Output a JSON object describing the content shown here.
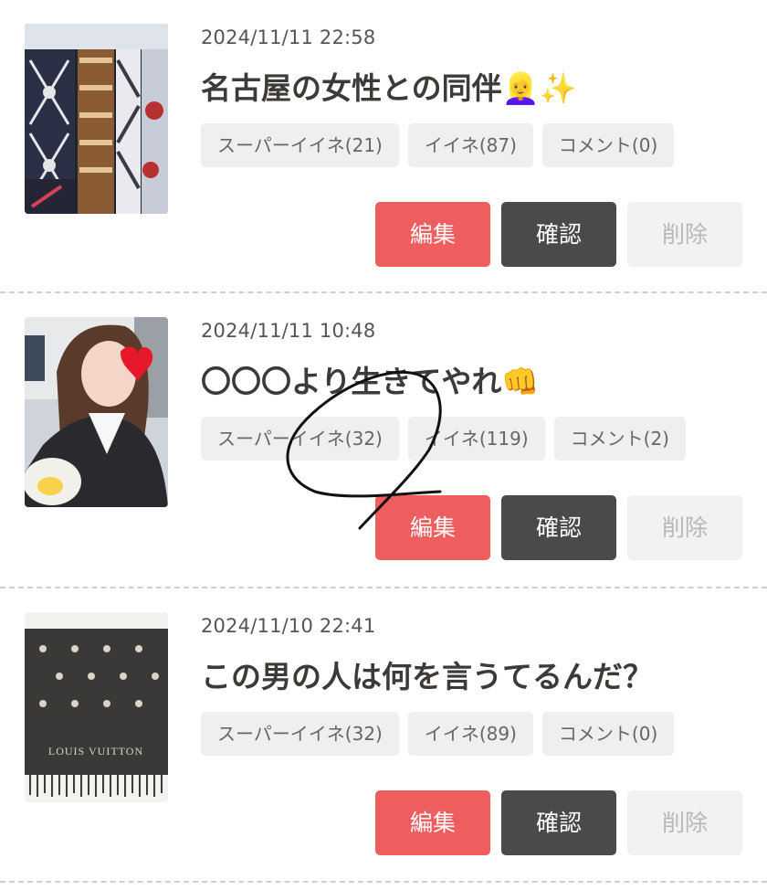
{
  "posts": [
    {
      "date": "2024/11/11 22:58",
      "title": "名古屋の女性との同伴👱‍♀️✨",
      "thumbnail_icon": "designer-scarves-photo",
      "super_like": "スーパーイイネ(21)",
      "like": "イイネ(87)",
      "comment": "コメント(0)",
      "edit": "編集",
      "confirm": "確認",
      "delete": "削除"
    },
    {
      "date": "2024/11/11 10:48",
      "title": "〇〇〇より生きてやれ👊",
      "thumbnail_icon": "woman-portrait-photo",
      "super_like": "スーパーイイネ(32)",
      "like": "イイネ(119)",
      "comment": "コメント(2)",
      "edit": "編集",
      "confirm": "確認",
      "delete": "削除"
    },
    {
      "date": "2024/11/10 22:41",
      "title": "この男の人は何を言うてるんだ？",
      "thumbnail_icon": "louis-vuitton-scarf-photo",
      "thumbnail_caption": "LOUIS VUITTON",
      "super_like": "スーパーイイネ(32)",
      "like": "イイネ(89)",
      "comment": "コメント(0)",
      "edit": "編集",
      "confirm": "確認",
      "delete": "削除"
    }
  ],
  "colors": {
    "edit_button": "#ef5e5e",
    "confirm_button": "#4a4a4a",
    "delete_button": "#f2f2f2",
    "chip_background": "#efefef",
    "divider": "#cfcfcf"
  }
}
